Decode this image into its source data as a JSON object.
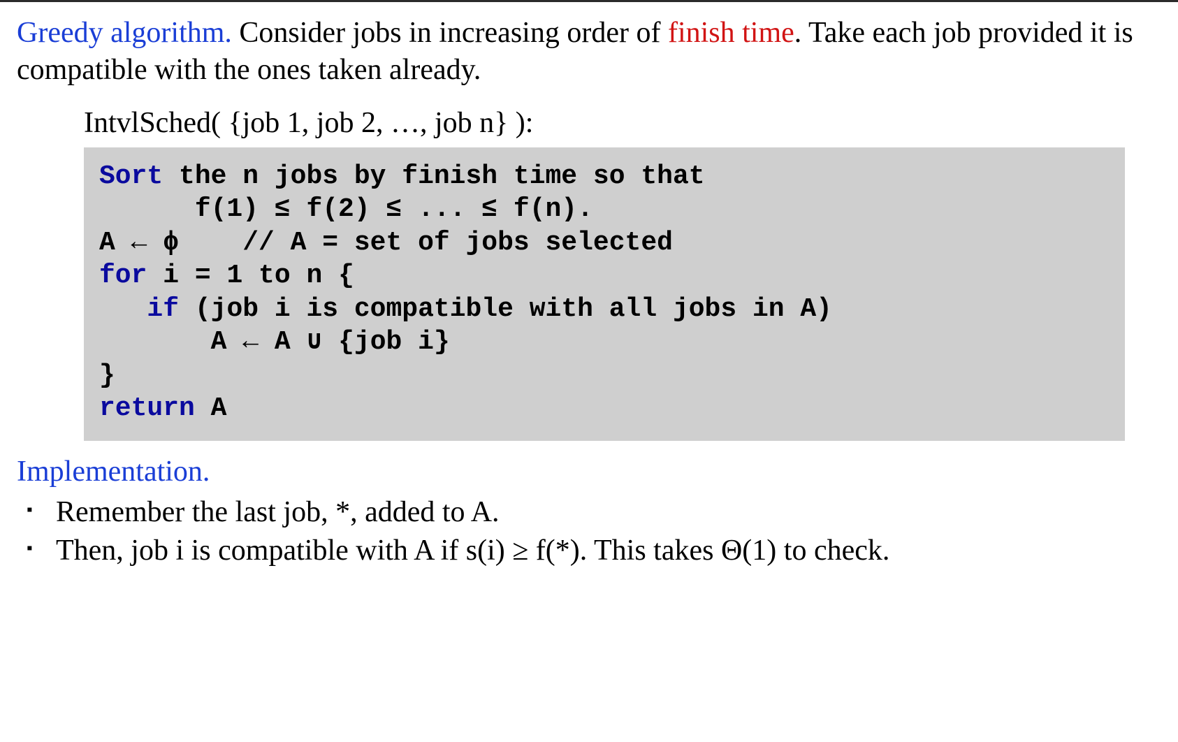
{
  "para1": {
    "greedy": "Greedy algorithm.",
    "consider_pre": "  Consider jobs in increasing order of ",
    "finish_time": "finish time",
    "consider_post": ". Take each job provided it is compatible with the ones taken already."
  },
  "func_signature": "IntvlSched( {job 1, job 2, …, job n} ):",
  "code": {
    "l1_kw": "Sort",
    "l1_rest": " the n jobs by finish time so that",
    "l2": "      f(1) ≤ f(2) ≤ ... ≤ f(n).",
    "l3": "A ← ϕ    // A = set of jobs selected",
    "l4_kw": "for",
    "l4_rest": " i = 1 to n {",
    "l5_pre": "   ",
    "l5_kw": "if",
    "l5_rest": " (job i is compatible with all jobs in A)",
    "l6": "       A ← A ∪ {job i}",
    "l7": "}",
    "l8_kw": "return",
    "l8_rest": " A"
  },
  "impl_heading": "Implementation.",
  "bullets": [
    "Remember the last job, *, added to A.",
    "Then, job i is compatible with A if s(i) ≥ f(*). This takes Θ(1) to check."
  ]
}
